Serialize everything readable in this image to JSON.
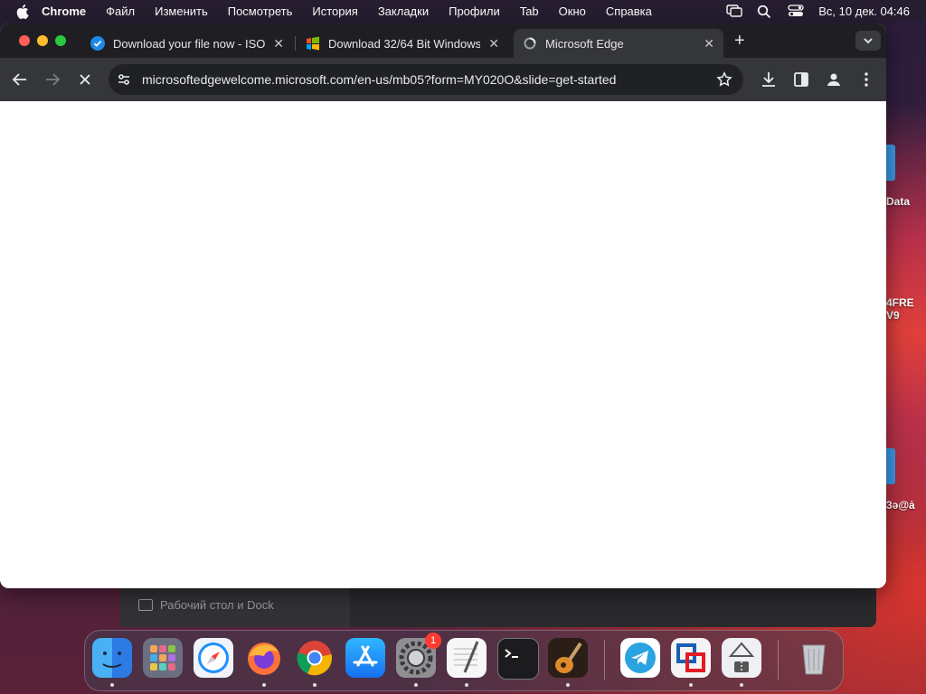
{
  "menubar": {
    "app_name": "Chrome",
    "items": [
      "Файл",
      "Изменить",
      "Посмотреть",
      "История",
      "Закладки",
      "Профили",
      "Tab",
      "Окно",
      "Справка"
    ],
    "clock": "Вс, 10 дек.  04:46"
  },
  "browser": {
    "tabs": [
      {
        "title": "Download your file now - ISO",
        "icon": "check-badge-icon",
        "active": false
      },
      {
        "title": "Download 32/64 Bit Windows",
        "icon": "windows-logo-icon",
        "active": false
      },
      {
        "title": "Microsoft Edge",
        "icon": "loading-favicon-icon",
        "active": true
      }
    ],
    "url": "microsoftedgewelcome.microsoft.com/en-us/mb05?form=MY020O&slide=get-started"
  },
  "background_window": {
    "sidebar_item": "Рабочий стол и Dock"
  },
  "desktop": {
    "labels": [
      "Data",
      "4FRE\nV9",
      "3ə@ȧ"
    ]
  },
  "dock": {
    "apps": [
      "Finder",
      "Launchpad",
      "Safari",
      "Firefox",
      "Google Chrome",
      "App Store",
      "System Settings",
      "TextEdit",
      "Terminal",
      "GarageBand",
      "Telegram",
      "Parallels",
      "Archive Utility",
      "Trash"
    ],
    "system_settings_badge": "1"
  },
  "colors": {
    "accent": "#3b9ae8",
    "tabstrip": "#1f1f23",
    "toolbar": "#35363a",
    "badge": "#ff3b30"
  }
}
